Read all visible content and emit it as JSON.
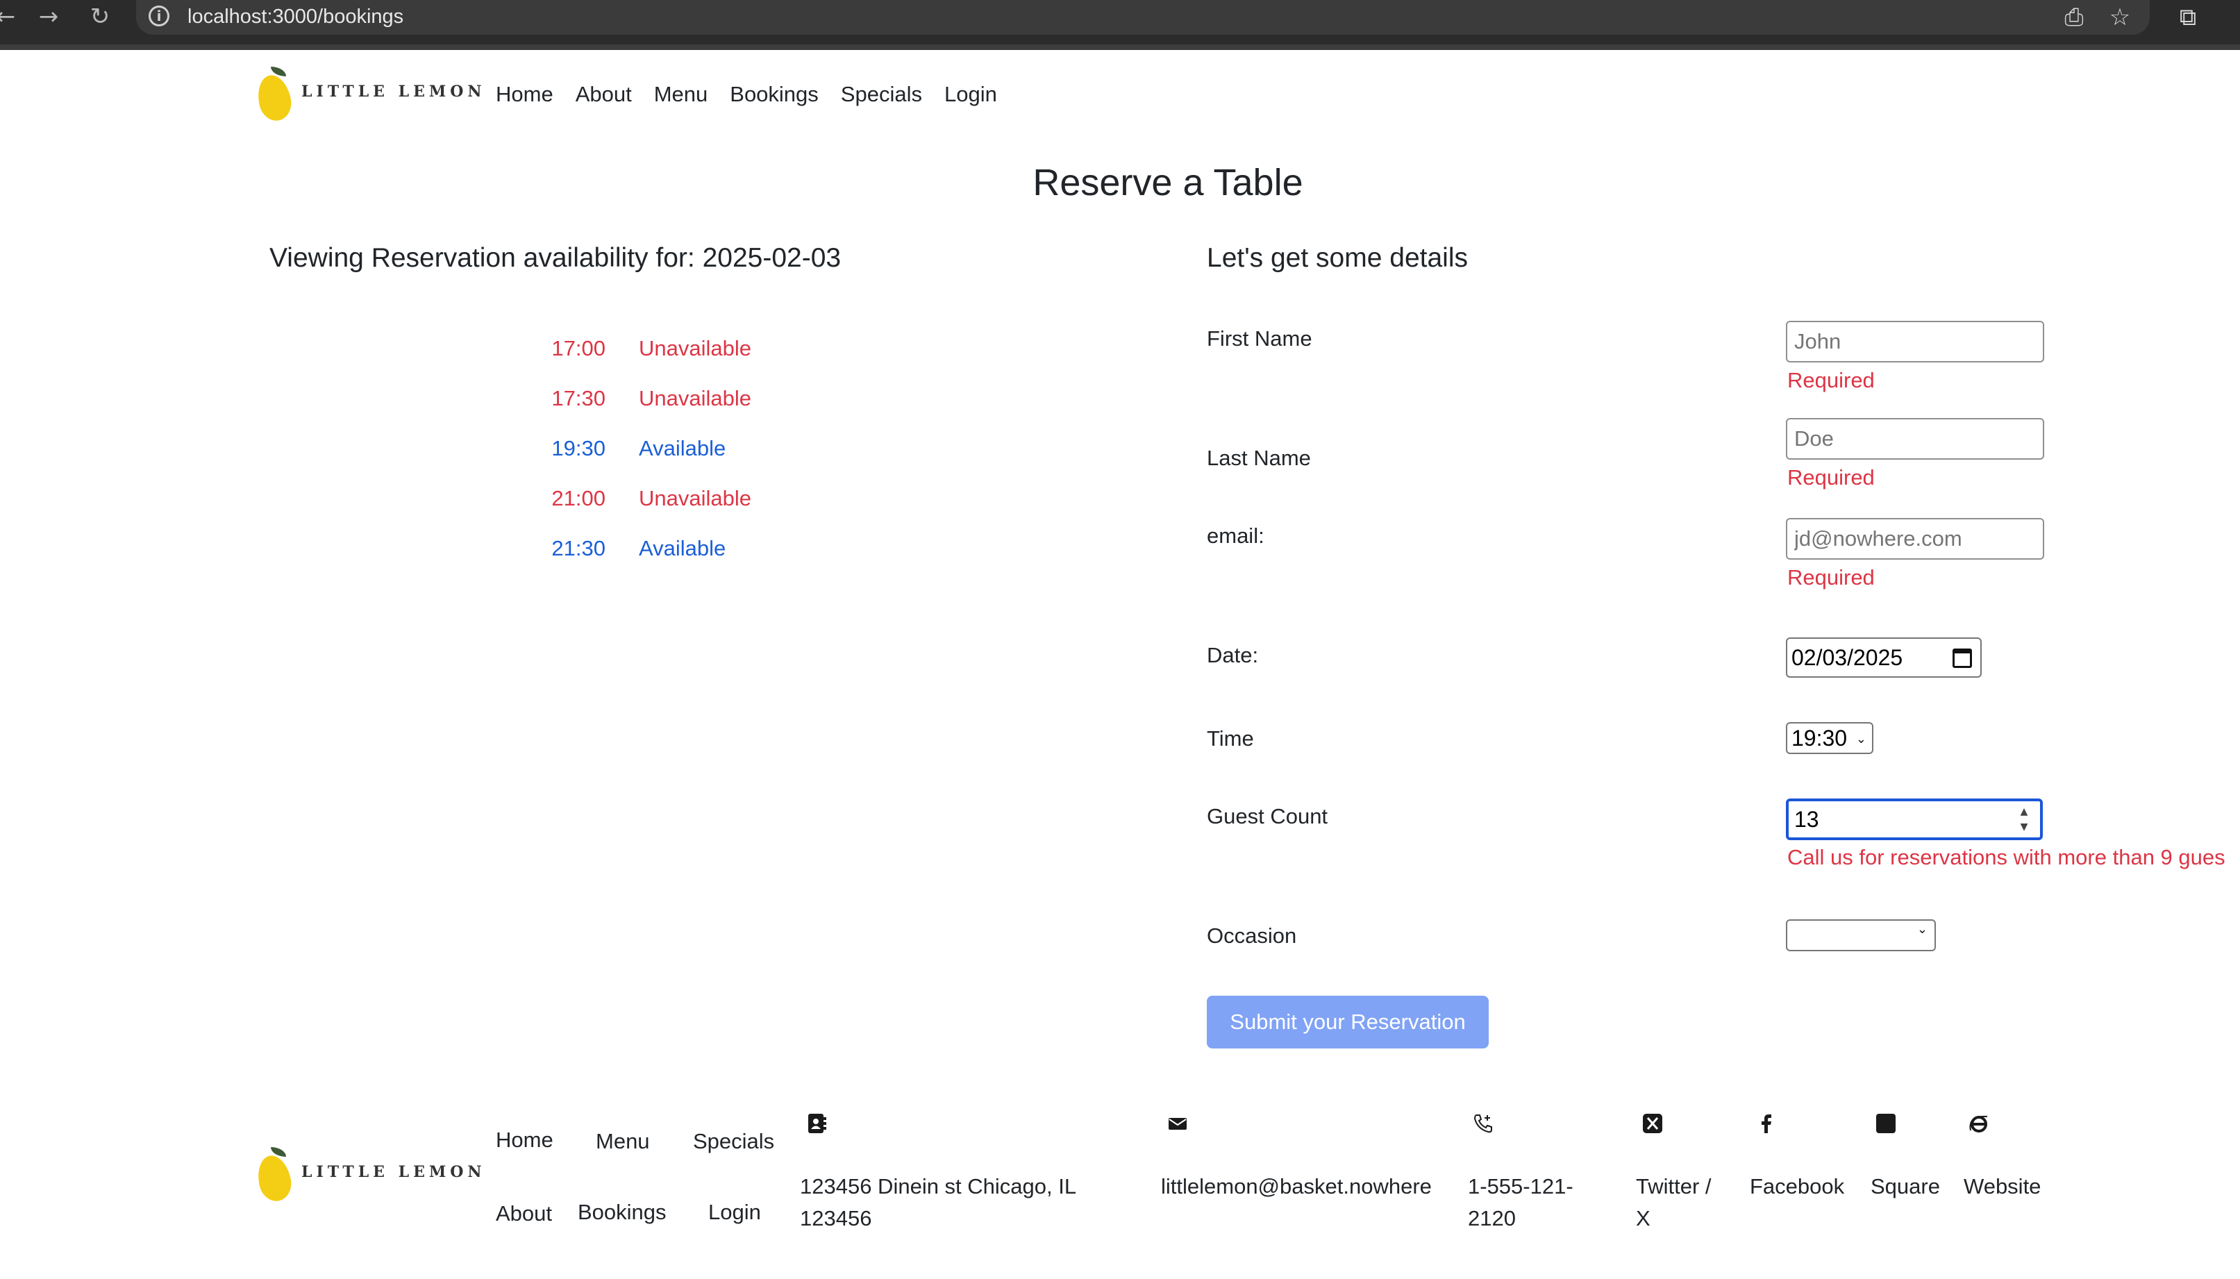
{
  "browser": {
    "url": "localhost:3000/bookings",
    "icons": [
      "back-arrow-icon",
      "forward-arrow-icon",
      "reload-icon",
      "site-info-icon",
      "install-app-icon",
      "star-icon",
      "extensions-icon"
    ]
  },
  "brand": {
    "name": "LITTLE LEMON",
    "colors": {
      "lemon": "#f4ce14",
      "leaf": "#3f5a36"
    }
  },
  "nav": {
    "items": [
      {
        "label": "Home"
      },
      {
        "label": "About"
      },
      {
        "label": "Menu"
      },
      {
        "label": "Bookings"
      },
      {
        "label": "Specials"
      },
      {
        "label": "Login"
      }
    ]
  },
  "page": {
    "title": "Reserve a Table",
    "availability_heading": "Viewing Reservation availability for: 2025-02-03",
    "form_heading": "Let's get some details"
  },
  "availability": [
    {
      "time": "17:00",
      "status": "Unavailable",
      "available": false
    },
    {
      "time": "17:30",
      "status": "Unavailable",
      "available": false
    },
    {
      "time": "19:30",
      "status": "Available",
      "available": true
    },
    {
      "time": "21:00",
      "status": "Unavailable",
      "available": false
    },
    {
      "time": "21:30",
      "status": "Available",
      "available": true
    }
  ],
  "form": {
    "first_name": {
      "label": "First Name",
      "placeholder": "John",
      "error": "Required"
    },
    "last_name": {
      "label": "Last Name",
      "placeholder": "Doe",
      "error": "Required"
    },
    "email": {
      "label": "email:",
      "placeholder": "jd@nowhere.com",
      "error": "Required"
    },
    "date": {
      "label": "Date:",
      "value": "02/03/2025"
    },
    "time": {
      "label": "Time",
      "value": "19:30"
    },
    "guests": {
      "label": "Guest Count",
      "value": "13",
      "error": "Call us for reservations with more than 9 gues"
    },
    "occasion": {
      "label": "Occasion",
      "value": ""
    },
    "submit_label": "Submit your Reservation"
  },
  "colors": {
    "error": "#dc3545",
    "available": "#1a5fd6",
    "submit_bg": "#80a3f5",
    "focus": "#1a56d8"
  },
  "footer": {
    "brand": "LITTLE LEMON",
    "links": [
      {
        "label": "Home"
      },
      {
        "label": "Menu"
      },
      {
        "label": "Specials"
      },
      {
        "label": "About"
      },
      {
        "label": "Bookings"
      },
      {
        "label": "Login"
      }
    ],
    "contact": {
      "address_line1": "123456 Dinein st Chicago, IL",
      "address_line2": "123456",
      "email": "littlelemon@basket.nowhere",
      "phone_line1": "1-555-121-",
      "phone_line2": "2120"
    },
    "social": {
      "twitter_line1": "Twitter /",
      "twitter_line2": "X",
      "facebook": "Facebook",
      "square": "Square",
      "website": "Website"
    }
  }
}
